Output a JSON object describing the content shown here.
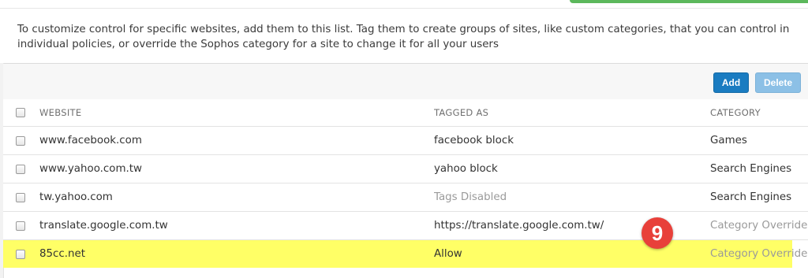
{
  "description": "To customize control for specific websites, add them to this list. Tag them to create groups of sites, like custom categories, that you can control in individual policies, or override the Sophos category for a site to change it for all your users",
  "toolbar": {
    "add_label": "Add",
    "delete_label": "Delete"
  },
  "table": {
    "headers": {
      "website": "WEBSITE",
      "tagged_as": "TAGGED AS",
      "category": "CATEGORY"
    },
    "rows": [
      {
        "website": "www.facebook.com",
        "tagged_as": "facebook block",
        "category": "Games"
      },
      {
        "website": "www.yahoo.com.tw",
        "tagged_as": "yahoo block",
        "category": "Search Engines"
      },
      {
        "website": "tw.yahoo.com",
        "tagged_as": "Tags Disabled",
        "category": "Search Engines"
      },
      {
        "website": "translate.google.com.tw",
        "tagged_as": "https://translate.google.com.tw/",
        "category": "Category Override D"
      },
      {
        "website": "85cc.net",
        "tagged_as": "Allow",
        "category": "Category Override D"
      }
    ]
  },
  "annotation": {
    "step_number": "9"
  },
  "colors": {
    "accent": "#1a7cc1",
    "highlight": "#ffff66",
    "badge": "#e8403a",
    "toast": "#5cb85c"
  }
}
